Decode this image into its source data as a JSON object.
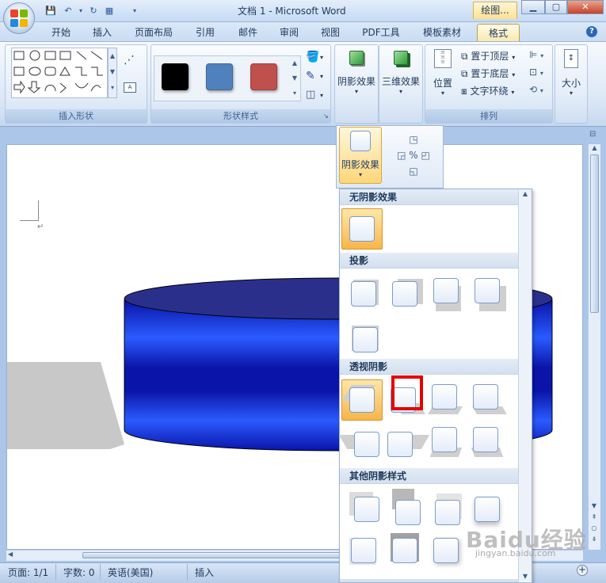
{
  "title_bar": {
    "doc_title": "文档 1 - Microsoft Word",
    "context_title": "绘图..."
  },
  "tabs": [
    "开始",
    "插入",
    "页面布局",
    "引用",
    "邮件",
    "审阅",
    "视图",
    "PDF工具",
    "模板素材",
    "格式"
  ],
  "active_tab": "格式",
  "ribbon": {
    "insert_shapes_label": "插入形状",
    "shape_styles_label": "形状样式",
    "style_swatch_colors": [
      "#000000",
      "#4f81bd",
      "#c0504d"
    ],
    "shadow_effect_label": "阴影效果",
    "three_d_label": "三维效果",
    "position_label": "位置",
    "bring_to_front_label": "置于顶层",
    "send_to_back_label": "置于底层",
    "text_wrap_label": "文字环绕",
    "arrange_label": "排列",
    "size_label": "大小"
  },
  "shadow_dropdown": {
    "button_label": "阴影效果",
    "sections": {
      "none": "无阴影效果",
      "drop": "投影",
      "perspective": "透视阴影",
      "other": "其他阴影样式"
    }
  },
  "document": {
    "shape_colors": {
      "top": "#2b2f8c",
      "body_dark": "#0a14a8",
      "body_light": "#2a5bff",
      "shadow": "#c8c8c8"
    }
  },
  "status_bar": {
    "page": "页面: 1/1",
    "words": "字数: 0",
    "language": "英语(美国)",
    "mode": "插入"
  },
  "watermark": {
    "text": "Baidu经验",
    "url": "jingyan.baidu.com"
  }
}
